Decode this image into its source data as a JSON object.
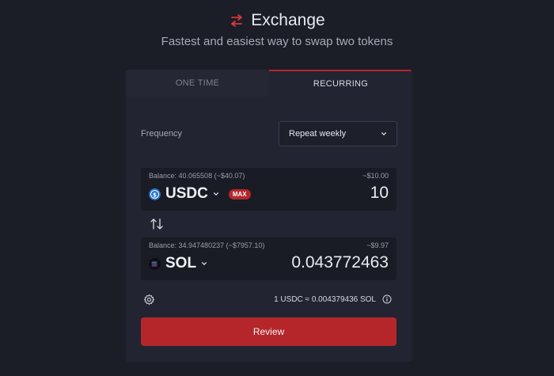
{
  "header": {
    "title": "Exchange",
    "subtitle": "Fastest and easiest way to swap two tokens"
  },
  "tabs": [
    {
      "label": "ONE TIME",
      "active": false
    },
    {
      "label": "RECURRING",
      "active": true
    }
  ],
  "frequency": {
    "label": "Frequency",
    "selected": "Repeat weekly"
  },
  "from": {
    "balance": "Balance: 40.065508 (~$40.07)",
    "usd_estimate": "~$10.00",
    "token": "USDC",
    "badge": "MAX",
    "amount": "10"
  },
  "to": {
    "balance": "Balance: 34.947480237 (~$7957.10)",
    "usd_estimate": "~$9.97",
    "token": "SOL",
    "amount": "0.043772463"
  },
  "rate": "1 USDC ≈ 0.004379436 SOL",
  "review_label": "Review",
  "colors": {
    "background": "#1b1d27",
    "card": "#222431",
    "accent": "#b5262b",
    "usdc": "#2775ca"
  },
  "icons": [
    "swap-icon",
    "chevron-down-icon",
    "usdc-logo-icon",
    "sol-logo-icon",
    "swap-direction-icon",
    "gear-icon",
    "info-icon"
  ]
}
